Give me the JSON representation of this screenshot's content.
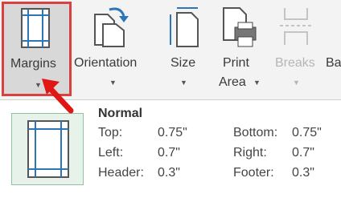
{
  "ribbon": {
    "margins": {
      "label": "Margins",
      "icon": "margins-icon"
    },
    "orientation": {
      "label": "Orientation",
      "icon": "orientation-icon"
    },
    "size": {
      "label": "Size",
      "icon": "size-icon"
    },
    "print_area": {
      "label_line1": "Print",
      "label_line2": "Area",
      "icon": "print-area-icon"
    },
    "breaks": {
      "label": "Breaks",
      "icon": "breaks-icon"
    },
    "cut_label": "Ba"
  },
  "dropdown": {
    "option_title": "Normal",
    "top_label": "Top:",
    "top_value": "0.75\"",
    "bottom_label": "Bottom:",
    "bottom_value": "0.75\"",
    "left_label": "Left:",
    "left_value": "0.7\"",
    "right_label": "Right:",
    "right_value": "0.7\"",
    "header_label": "Header:",
    "header_value": "0.3\"",
    "footer_label": "Footer:",
    "footer_value": "0.3\""
  },
  "colors": {
    "highlight_border": "#d94040",
    "icon_blue": "#2e75b6",
    "preview_bg": "#e6f2ea"
  }
}
